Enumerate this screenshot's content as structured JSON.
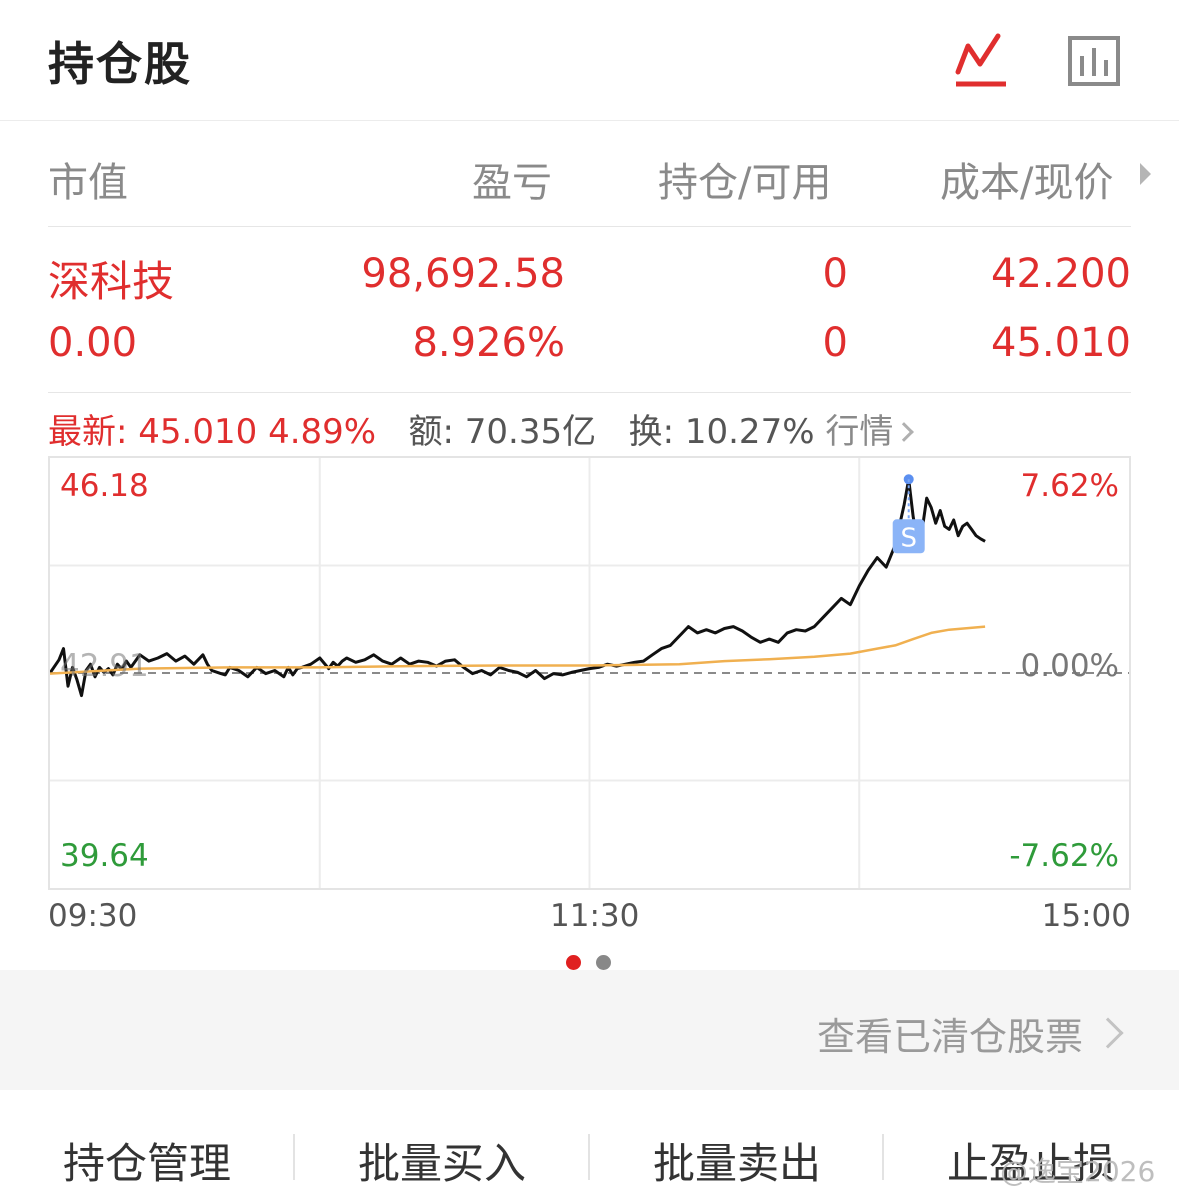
{
  "header": {
    "title": "持仓股",
    "tabs": [
      {
        "name": "line-chart-icon",
        "active": true
      },
      {
        "name": "bar-chart-icon",
        "active": false
      }
    ]
  },
  "columns": {
    "market_value": "市值",
    "pnl": "盈亏",
    "position": "持仓/可用",
    "cost_price": "成本/现价"
  },
  "holding": {
    "name": "深科技",
    "market_value": "0.00",
    "pnl_amount": "98,692.58",
    "pnl_pct": "8.926%",
    "position": "0",
    "available": "0",
    "cost": "42.200",
    "price": "45.010"
  },
  "quote": {
    "latest_label": "最新:",
    "latest_price": "45.010",
    "change_pct": "4.89%",
    "amount_label": "额:",
    "amount": "70.35亿",
    "turnover_label": "换:",
    "turnover": "10.27%",
    "market_link": "行情"
  },
  "chart_data": {
    "type": "line",
    "prev_close": 42.91,
    "y_max": 46.18,
    "y_min": 39.64,
    "y_max_pct": "7.62%",
    "y_min_pct": "-7.62%",
    "zero_pct": "0.00%",
    "y_max_label": "46.18",
    "y_min_label": "39.64",
    "prev_close_label": "42.91",
    "x_labels": [
      "09:30",
      "11:30",
      "15:00"
    ],
    "total_minutes": 240,
    "marker": {
      "label": "S",
      "minute": 191
    },
    "series": [
      {
        "name": "price",
        "color": "#111111",
        "points": [
          [
            0,
            42.91
          ],
          [
            2,
            43.12
          ],
          [
            3,
            43.3
          ],
          [
            4,
            42.7
          ],
          [
            5,
            43.0
          ],
          [
            6,
            42.8
          ],
          [
            7,
            42.55
          ],
          [
            8,
            42.95
          ],
          [
            9,
            43.05
          ],
          [
            10,
            42.85
          ],
          [
            11,
            43.0
          ],
          [
            12,
            42.92
          ],
          [
            13,
            42.98
          ],
          [
            14,
            42.88
          ],
          [
            15,
            43.05
          ],
          [
            16,
            42.97
          ],
          [
            17,
            43.1
          ],
          [
            18,
            43.0
          ],
          [
            20,
            43.2
          ],
          [
            22,
            43.1
          ],
          [
            24,
            43.15
          ],
          [
            26,
            43.22
          ],
          [
            28,
            43.1
          ],
          [
            30,
            43.18
          ],
          [
            32,
            43.05
          ],
          [
            34,
            43.2
          ],
          [
            35,
            43.05
          ],
          [
            36,
            42.95
          ],
          [
            38,
            42.9
          ],
          [
            39,
            42.88
          ],
          [
            40,
            43.0
          ],
          [
            42,
            42.95
          ],
          [
            44,
            42.85
          ],
          [
            46,
            43.0
          ],
          [
            48,
            42.9
          ],
          [
            50,
            42.95
          ],
          [
            52,
            42.85
          ],
          [
            53,
            43.0
          ],
          [
            54,
            42.88
          ],
          [
            55,
            42.98
          ],
          [
            56,
            43.0
          ],
          [
            58,
            43.05
          ],
          [
            60,
            43.15
          ],
          [
            62,
            42.98
          ],
          [
            63,
            43.08
          ],
          [
            64,
            43.02
          ],
          [
            65,
            43.1
          ],
          [
            66,
            43.15
          ],
          [
            68,
            43.08
          ],
          [
            70,
            43.12
          ],
          [
            72,
            43.2
          ],
          [
            74,
            43.1
          ],
          [
            76,
            43.05
          ],
          [
            78,
            43.15
          ],
          [
            80,
            43.05
          ],
          [
            82,
            43.1
          ],
          [
            84,
            43.08
          ],
          [
            86,
            43.02
          ],
          [
            88,
            43.1
          ],
          [
            90,
            43.12
          ],
          [
            92,
            43.0
          ],
          [
            94,
            42.9
          ],
          [
            96,
            42.95
          ],
          [
            98,
            42.88
          ],
          [
            100,
            43.0
          ],
          [
            102,
            42.95
          ],
          [
            104,
            42.92
          ],
          [
            106,
            42.85
          ],
          [
            108,
            42.95
          ],
          [
            110,
            42.82
          ],
          [
            112,
            42.9
          ],
          [
            114,
            42.88
          ],
          [
            116,
            42.92
          ],
          [
            118,
            42.95
          ],
          [
            120,
            42.98
          ],
          [
            122,
            43.0
          ],
          [
            124,
            43.05
          ],
          [
            126,
            43.02
          ],
          [
            128,
            43.05
          ],
          [
            130,
            43.08
          ],
          [
            132,
            43.1
          ],
          [
            134,
            43.2
          ],
          [
            136,
            43.3
          ],
          [
            138,
            43.35
          ],
          [
            140,
            43.5
          ],
          [
            142,
            43.65
          ],
          [
            144,
            43.55
          ],
          [
            146,
            43.6
          ],
          [
            148,
            43.55
          ],
          [
            150,
            43.62
          ],
          [
            152,
            43.65
          ],
          [
            154,
            43.58
          ],
          [
            156,
            43.48
          ],
          [
            158,
            43.4
          ],
          [
            160,
            43.45
          ],
          [
            162,
            43.4
          ],
          [
            164,
            43.55
          ],
          [
            166,
            43.6
          ],
          [
            168,
            43.58
          ],
          [
            170,
            43.65
          ],
          [
            172,
            43.8
          ],
          [
            174,
            43.95
          ],
          [
            176,
            44.1
          ],
          [
            178,
            44.0
          ],
          [
            180,
            44.3
          ],
          [
            182,
            44.55
          ],
          [
            184,
            44.75
          ],
          [
            186,
            44.6
          ],
          [
            188,
            44.95
          ],
          [
            190,
            45.6
          ],
          [
            191,
            46.0
          ],
          [
            192,
            45.4
          ],
          [
            193,
            45.0
          ],
          [
            194,
            45.2
          ],
          [
            195,
            45.7
          ],
          [
            196,
            45.55
          ],
          [
            197,
            45.3
          ],
          [
            198,
            45.5
          ],
          [
            199,
            45.25
          ],
          [
            200,
            45.2
          ],
          [
            201,
            45.35
          ],
          [
            202,
            45.1
          ],
          [
            203,
            45.25
          ],
          [
            204,
            45.3
          ],
          [
            205,
            45.2
          ],
          [
            206,
            45.1
          ],
          [
            207,
            45.05
          ],
          [
            208,
            45.01
          ]
        ]
      },
      {
        "name": "average",
        "color": "#f0b050",
        "points": [
          [
            0,
            42.9
          ],
          [
            20,
            42.98
          ],
          [
            40,
            43.0
          ],
          [
            60,
            43.0
          ],
          [
            80,
            43.02
          ],
          [
            100,
            43.03
          ],
          [
            120,
            43.03
          ],
          [
            140,
            43.05
          ],
          [
            150,
            43.1
          ],
          [
            160,
            43.13
          ],
          [
            170,
            43.17
          ],
          [
            178,
            43.22
          ],
          [
            184,
            43.3
          ],
          [
            188,
            43.35
          ],
          [
            192,
            43.45
          ],
          [
            196,
            43.55
          ],
          [
            200,
            43.6
          ],
          [
            208,
            43.65
          ]
        ]
      }
    ]
  },
  "pager": {
    "dots": [
      {
        "active": true,
        "color": "#e02020"
      },
      {
        "active": false,
        "color": "#888888"
      }
    ]
  },
  "cleared": {
    "label": "查看已清仓股票"
  },
  "bottom": {
    "buttons": [
      "持仓管理",
      "批量买入",
      "批量卖出",
      "止盈止损"
    ]
  },
  "watermark": "@逸宝2026",
  "colors": {
    "red": "#e02e2e",
    "green": "#2f9b3a",
    "price_line": "#111111",
    "avg_line": "#f0b050"
  }
}
